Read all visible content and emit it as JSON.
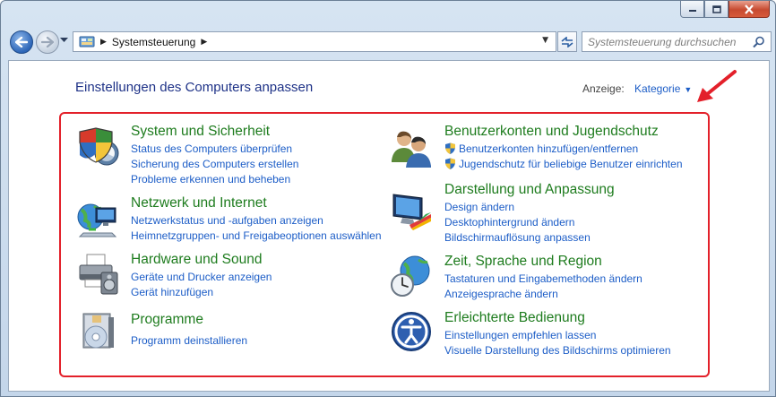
{
  "window": {
    "controls": [
      "minimize",
      "maximize",
      "close"
    ]
  },
  "address_bar": {
    "path": "Systemsteuerung",
    "search_placeholder": "Systemsteuerung durchsuchen"
  },
  "content": {
    "title": "Einstellungen des Computers anpassen",
    "view_label": "Anzeige:",
    "view_value": "Kategorie"
  },
  "categories": [
    {
      "title": "System und Sicherheit",
      "icon": "system-security-icon",
      "links": [
        "Status des Computers überprüfen",
        "Sicherung des Computers erstellen",
        "Probleme erkennen und beheben"
      ]
    },
    {
      "title": "Netzwerk und Internet",
      "icon": "network-icon",
      "links": [
        "Netzwerkstatus und -aufgaben anzeigen",
        "Heimnetzgruppen- und Freigabeoptionen auswählen"
      ]
    },
    {
      "title": "Hardware und Sound",
      "icon": "printer-icon",
      "links": [
        "Geräte und Drucker anzeigen",
        "Gerät hinzufügen"
      ]
    },
    {
      "title": "Programme",
      "icon": "programs-icon",
      "links": [
        "Programm deinstallieren"
      ]
    },
    {
      "title": "Benutzerkonten und Jugendschutz",
      "icon": "users-icon",
      "links": [
        "Benutzerkonten hinzufügen/entfernen",
        "Jugendschutz für beliebige Benutzer einrichten"
      ]
    },
    {
      "title": "Darstellung und Anpassung",
      "icon": "display-icon",
      "links": [
        "Design ändern",
        "Desktophintergrund ändern",
        "Bildschirmauflösung anpassen"
      ]
    },
    {
      "title": "Zeit, Sprache und Region",
      "icon": "clock-globe-icon",
      "links": [
        "Tastaturen und Eingabemethoden ändern",
        "Anzeigesprache ändern"
      ]
    },
    {
      "title": "Erleichterte Bedienung",
      "icon": "accessibility-icon",
      "links": [
        "Einstellungen empfehlen lassen",
        "Visuelle Darstellung des Bildschirms optimieren"
      ]
    }
  ],
  "colors": {
    "category_title": "#1e7c1e",
    "link": "#1c5dc7",
    "page_title": "#1e3287",
    "annotation": "#e3202a"
  }
}
